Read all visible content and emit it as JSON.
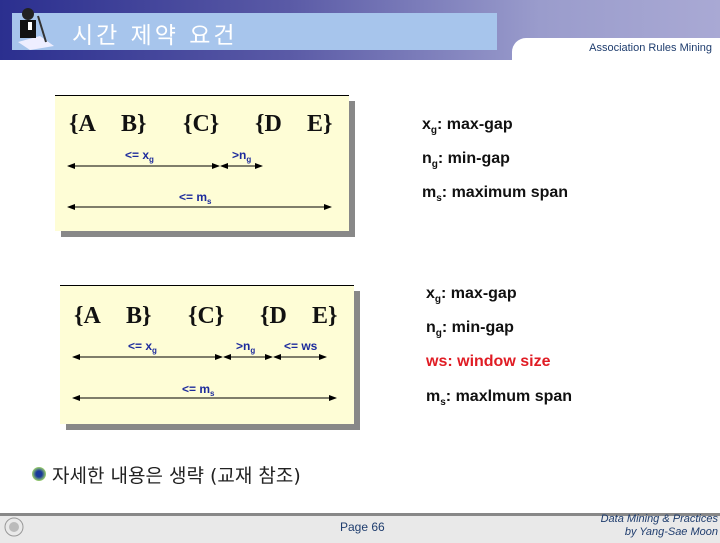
{
  "header": {
    "title": "시간 제약 요건",
    "subtitle": "Association Rules Mining"
  },
  "diagram1": {
    "sets": [
      "{A",
      "B}",
      "{C}",
      "{D",
      "E}"
    ],
    "labels": {
      "xg": "<= x",
      "xg_sub": "g",
      "ng": ">n",
      "ng_sub": "g",
      "ms": "<= m",
      "ms_sub": "s"
    }
  },
  "diagram2": {
    "sets": [
      "{A",
      "B}",
      "{C}",
      "{D",
      "E}"
    ],
    "labels": {
      "xg": "<= x",
      "xg_sub": "g",
      "ng": ">n",
      "ng_sub": "g",
      "ws": "<= ws",
      "ms": "<= m",
      "ms_sub": "s"
    }
  },
  "defs1": [
    {
      "sym": "x",
      "sub": "g",
      "text": ": max-gap"
    },
    {
      "sym": "n",
      "sub": "g",
      "text": ": min-gap"
    },
    {
      "sym": "m",
      "sub": "s",
      "text": ": maximum span"
    }
  ],
  "defs2": [
    {
      "sym": "x",
      "sub": "g",
      "text": ": max-gap"
    },
    {
      "sym": "n",
      "sub": "g",
      "text": ": min-gap"
    },
    {
      "sym": "ws",
      "sub": "",
      "text": ": window size"
    },
    {
      "sym": "m",
      "sub": "s",
      "text": ": maxlmum span"
    }
  ],
  "bullet": "자세한 내용은 생략 (교재 참조)",
  "footer": {
    "page": "Page 66",
    "credit1": "Data Mining & Practices",
    "credit2": "by Yang-Sae Moon",
    "logo": "컴퓨터과학과"
  },
  "colors": {
    "box_bg": "#fefdd6",
    "label": "#1d2b9c",
    "red": "#e01c24"
  }
}
